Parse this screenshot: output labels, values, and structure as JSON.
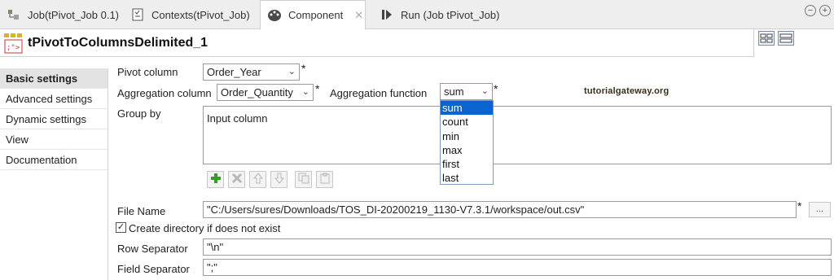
{
  "tabs": [
    {
      "label": "Job(tPivot_Job 0.1)",
      "icon": "job-icon"
    },
    {
      "label": "Contexts(tPivot_Job)",
      "icon": "contexts-icon"
    },
    {
      "label": "Component",
      "icon": "component-palette-icon",
      "active": true
    },
    {
      "label": "Run (Job tPivot_Job)",
      "icon": "run-icon"
    }
  ],
  "window": {
    "minimize_symbol": "−",
    "maximize_symbol": "+"
  },
  "component": {
    "title": "tPivotToColumnsDelimited_1"
  },
  "sidebar": {
    "items": [
      {
        "label": "Basic settings",
        "active": true
      },
      {
        "label": "Advanced settings"
      },
      {
        "label": "Dynamic settings"
      },
      {
        "label": "View"
      },
      {
        "label": "Documentation"
      }
    ]
  },
  "form": {
    "pivot_column": {
      "label": "Pivot column",
      "value": "Order_Year"
    },
    "aggregation_column": {
      "label": "Aggregation column",
      "value": "Order_Quantity"
    },
    "aggregation_function": {
      "label": "Aggregation function",
      "value": "sum",
      "options": [
        "sum",
        "count",
        "min",
        "max",
        "first",
        "last"
      ],
      "selected_index": 0
    },
    "required_marker": "*",
    "group_by": {
      "label": "Group by",
      "column_header": "Input column"
    },
    "file_name": {
      "label": "File Name",
      "value": "\"C:/Users/sures/Downloads/TOS_DI-20200219_1130-V7.3.1/workspace/out.csv\"",
      "browse_label": "..."
    },
    "create_directory": {
      "label": "Create directory if does not exist",
      "checked": true
    },
    "row_separator": {
      "label": "Row Separator",
      "value": "\"\\n\""
    },
    "field_separator": {
      "label": "Field Separator",
      "value": "\";\""
    }
  },
  "watermark": "tutorialgateway.org",
  "colors": {
    "selection": "#0a64d0",
    "add_green": "#3a9a2a"
  }
}
